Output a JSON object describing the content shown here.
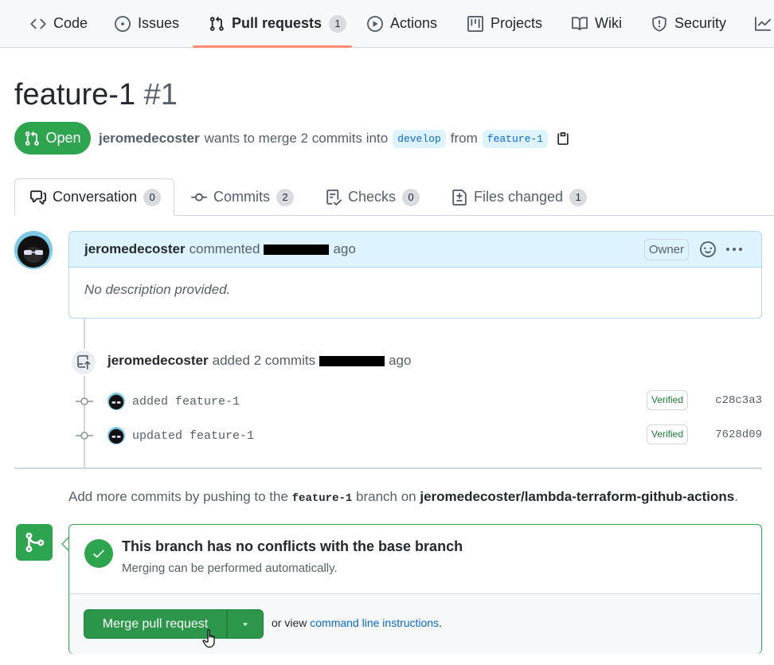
{
  "repo_nav": {
    "items": [
      {
        "label": "Code",
        "icon": "code-icon"
      },
      {
        "label": "Issues",
        "icon": "issue-opened-icon"
      },
      {
        "label": "Pull requests",
        "icon": "git-pull-request-icon",
        "count": "1",
        "active": true
      },
      {
        "label": "Actions",
        "icon": "play-icon"
      },
      {
        "label": "Projects",
        "icon": "table-icon"
      },
      {
        "label": "Wiki",
        "icon": "book-icon"
      },
      {
        "label": "Security",
        "icon": "shield-icon"
      }
    ]
  },
  "pr": {
    "title": "feature-1",
    "number": "#1",
    "state": "Open",
    "author": "jeromedecoster",
    "merge_text": "wants to merge 2 commits into",
    "base_branch": "develop",
    "from_text": "from",
    "head_branch": "feature-1"
  },
  "tabs": [
    {
      "label": "Conversation",
      "count": "0",
      "icon": "comment-discussion-icon"
    },
    {
      "label": "Commits",
      "count": "2",
      "icon": "git-commit-icon"
    },
    {
      "label": "Checks",
      "count": "0",
      "icon": "checklist-icon"
    },
    {
      "label": "Files changed",
      "count": "1",
      "icon": "file-diff-icon"
    }
  ],
  "comment": {
    "author": "jeromedecoster",
    "action": "commented",
    "time_suffix": "ago",
    "owner_label": "Owner",
    "body": "No description provided."
  },
  "commit_event": {
    "author": "jeromedecoster",
    "action": "added 2 commits",
    "time_suffix": "ago"
  },
  "commits": [
    {
      "message": "added feature-1",
      "verified": "Verified",
      "sha": "c28c3a3"
    },
    {
      "message": "updated feature-1",
      "verified": "Verified",
      "sha": "7628d09"
    }
  ],
  "push_hint": {
    "prefix": "Add more commits by pushing to the",
    "branch": "feature-1",
    "middle": "branch on",
    "repo": "jeromedecoster/lambda-terraform-github-actions",
    "suffix": "."
  },
  "merge": {
    "title": "This branch has no conflicts with the base branch",
    "subtitle": "Merging can be performed automatically.",
    "button": "Merge pull request",
    "or_view": "or view",
    "link": "command line instructions",
    "period": "."
  },
  "colors": {
    "accent_green": "#2da44e",
    "link_blue": "#0969da",
    "nav_underline": "#fd8c73"
  }
}
